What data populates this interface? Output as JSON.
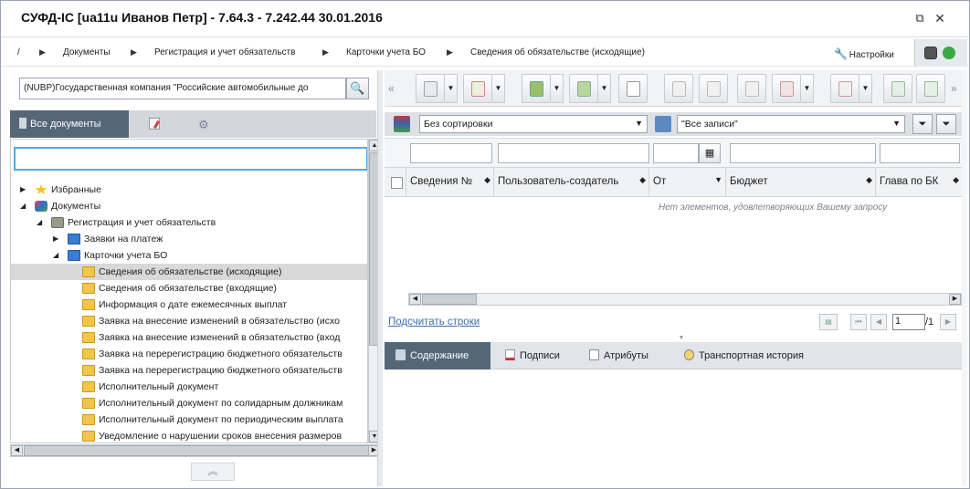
{
  "window": {
    "title": "СУФД-IC [ua11u Иванов Петр] - 7.64.3 - 7.242.44 30.01.2016",
    "restore_icon": "restore-icon",
    "close_icon": "close-icon"
  },
  "breadcrumbs": {
    "root": "/",
    "items": [
      "Документы",
      "Регистрация и учет обязательств",
      "Карточки учета БО",
      "Сведения об обязательстве (исходящие)"
    ]
  },
  "settings": {
    "label": "Настройки"
  },
  "left": {
    "org_value": "(NUBP)Государственная компания \"Российские автомобильные до",
    "tabs": [
      {
        "label": "Все документы",
        "icon": "documents-icon"
      },
      {
        "label": "",
        "icon": "edit-doc-icon"
      },
      {
        "label": "",
        "icon": "gear-icon"
      }
    ],
    "tree_search_value": "",
    "tree": [
      {
        "label": "Избранные",
        "icon": "star-icon",
        "level": 0,
        "toggle": "▶"
      },
      {
        "label": "Документы",
        "icon": "documents-group-icon",
        "level": 0,
        "toggle": "◢"
      },
      {
        "label": "Регистрация и учет обязательств",
        "icon": "folder-box-icon",
        "level": 1,
        "toggle": "◢"
      },
      {
        "label": "Заявки на платеж",
        "icon": "book-icon",
        "level": 2,
        "toggle": "▶"
      },
      {
        "label": "Карточки учета БО",
        "icon": "book-icon",
        "level": 2,
        "toggle": "◢"
      },
      {
        "label": "Сведения об обязательстве (исходящие)",
        "icon": "folder-icon",
        "level": 3,
        "toggle": "",
        "selected": true
      },
      {
        "label": "Сведения об обязательстве (входящие)",
        "icon": "folder-icon",
        "level": 3,
        "toggle": ""
      },
      {
        "label": "Информация о дате ежемесячных выплат",
        "icon": "folder-icon",
        "level": 3,
        "toggle": ""
      },
      {
        "label": "Заявка на внесение изменений в обязательство (исхо",
        "icon": "folder-icon",
        "level": 3,
        "toggle": ""
      },
      {
        "label": "Заявка на внесение изменений в обязательство (вход",
        "icon": "folder-icon",
        "level": 3,
        "toggle": ""
      },
      {
        "label": "Заявка на перерегистрацию бюджетного обязательств",
        "icon": "folder-icon",
        "level": 3,
        "toggle": ""
      },
      {
        "label": "Заявка на перерегистрацию бюджетного обязательств",
        "icon": "folder-icon",
        "level": 3,
        "toggle": ""
      },
      {
        "label": "Исполнительный документ",
        "icon": "folder-icon",
        "level": 3,
        "toggle": ""
      },
      {
        "label": "Исполнительный документ по солидарным должникам",
        "icon": "folder-icon",
        "level": 3,
        "toggle": ""
      },
      {
        "label": "Исполнительный документ по периодическим выплата",
        "icon": "folder-icon",
        "level": 3,
        "toggle": ""
      },
      {
        "label": "Уведомление о нарушении сроков внесения размеров",
        "icon": "folder-icon",
        "level": 3,
        "toggle": ""
      }
    ]
  },
  "filterbar": {
    "sort_value": "Без сортировки",
    "records_value": "\"Все записи\""
  },
  "grid": {
    "columns": [
      {
        "label": "Сведения №"
      },
      {
        "label": "Пользователь-создатель"
      },
      {
        "label": "От"
      },
      {
        "label": "Бюджет"
      },
      {
        "label": "Глава по БК"
      }
    ],
    "empty_text": "Нет элементов, удовлетворяющих Вашему запросу"
  },
  "pager": {
    "count_link": "Подсчитать строки",
    "page_value": "1",
    "total": "/1"
  },
  "bottom_tabs": [
    {
      "label": "Содержание",
      "icon": "content-icon",
      "active": true
    },
    {
      "label": "Подписи",
      "icon": "signature-icon",
      "active": false
    },
    {
      "label": "Атрибуты",
      "icon": "attributes-icon",
      "active": false
    },
    {
      "label": "Транспортная история",
      "icon": "transport-history-icon",
      "active": false
    }
  ],
  "colors": {
    "accent_tab": "#556677",
    "link": "#3a6fb0",
    "folder": "#f3c64b",
    "selected_row": "#d9d9d9"
  }
}
